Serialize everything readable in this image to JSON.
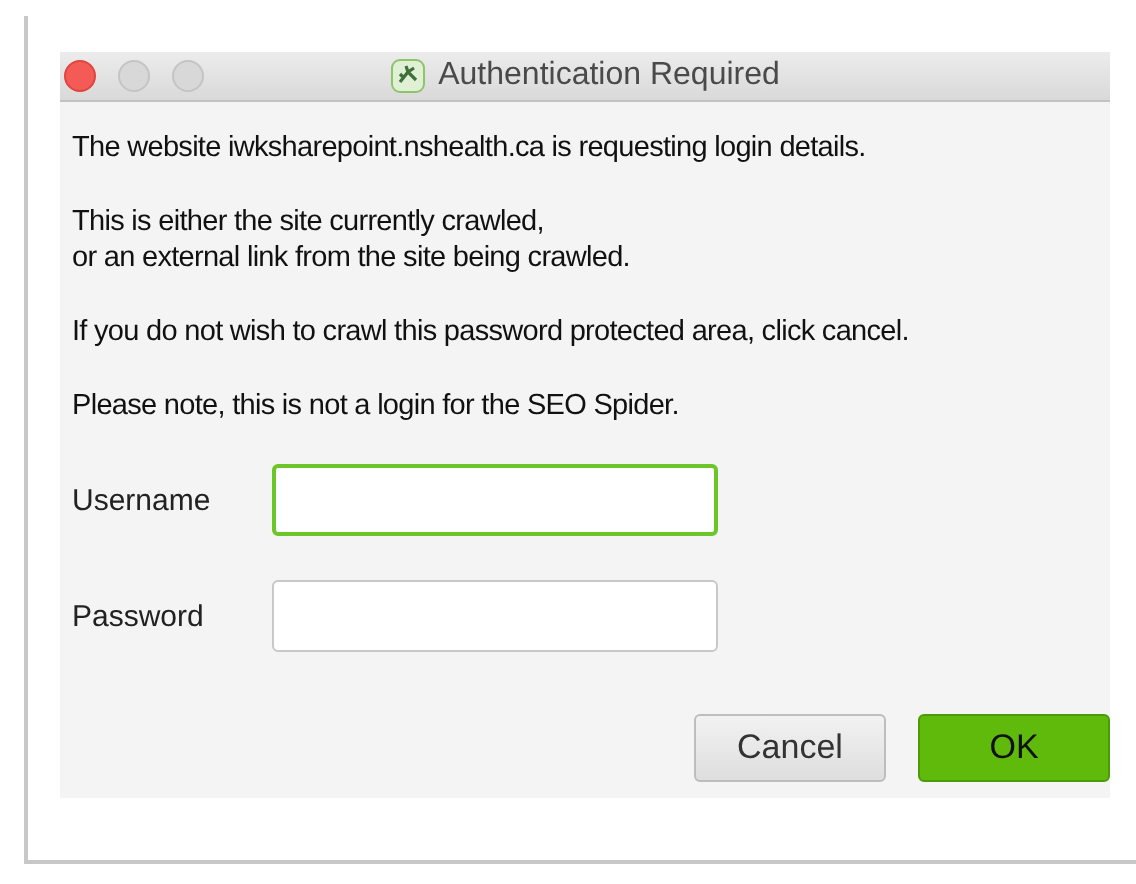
{
  "window": {
    "title": "Authentication Required"
  },
  "paragraphs": [
    {
      "lines": [
        "The website iwksharepoint.nshealth.ca is requesting login details."
      ]
    },
    {
      "lines": [
        "This is either the site currently crawled,",
        "or an external link from the site being crawled."
      ]
    },
    {
      "lines": [
        "If you do not wish to crawl this password protected area, click cancel."
      ]
    },
    {
      "lines": [
        "Please note, this is not a login for the SEO Spider."
      ]
    }
  ],
  "fields": [
    {
      "label": "Username",
      "focused": true
    },
    {
      "label": "Password",
      "focused": false
    }
  ],
  "buttons": [
    {
      "label": "Cancel",
      "kind": "secondary"
    },
    {
      "label": "OK",
      "kind": "primary"
    }
  ]
}
